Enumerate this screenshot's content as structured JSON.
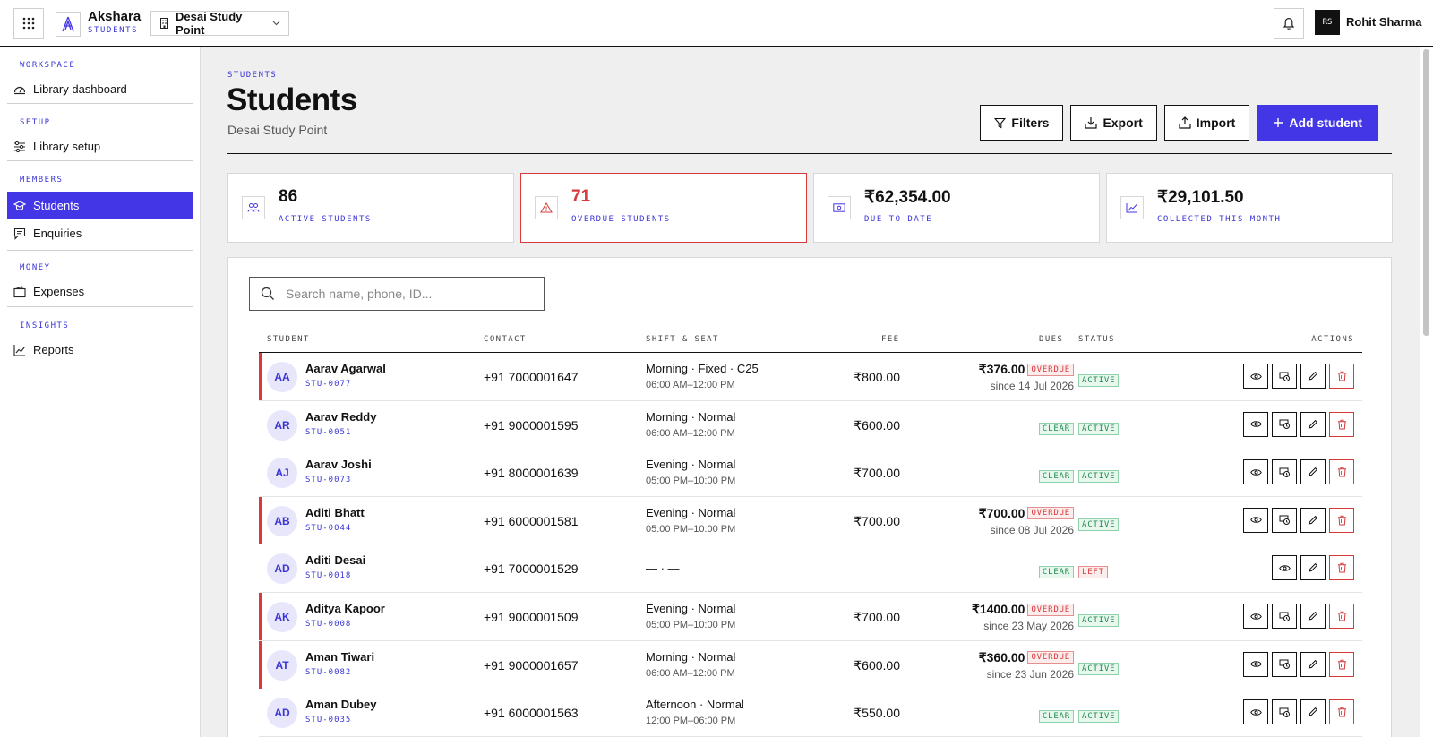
{
  "topbar": {
    "brand": "Akshara",
    "brand_sub": "STUDENTS",
    "branch": "Desai Study Point",
    "user_initials": "RS",
    "user_name": "Rohit Sharma"
  },
  "sidebar": {
    "sections": [
      {
        "label": "WORKSPACE",
        "items": [
          {
            "label": "Library dashboard",
            "icon": "dashboard-icon"
          }
        ]
      },
      {
        "label": "SETUP",
        "items": [
          {
            "label": "Library setup",
            "icon": "sliders-icon"
          }
        ]
      },
      {
        "label": "MEMBERS",
        "items": [
          {
            "label": "Students",
            "icon": "graduation-cap-icon",
            "active": true
          },
          {
            "label": "Enquiries",
            "icon": "chat-icon"
          }
        ]
      },
      {
        "label": "MONEY",
        "items": [
          {
            "label": "Expenses",
            "icon": "wallet-icon"
          }
        ]
      },
      {
        "label": "INSIGHTS",
        "items": [
          {
            "label": "Reports",
            "icon": "line-chart-icon"
          }
        ]
      }
    ]
  },
  "page": {
    "breadcrumb": "STUDENTS",
    "title": "Students",
    "subtitle": "Desai Study Point",
    "buttons": {
      "filters": "Filters",
      "export": "Export",
      "import": "Import",
      "add": "Add student"
    }
  },
  "stats": [
    {
      "value": "86",
      "label": "ACTIVE STUDENTS",
      "icon": "users-icon"
    },
    {
      "value": "71",
      "label": "OVERDUE STUDENTS",
      "icon": "warning-icon"
    },
    {
      "value": "₹62,354.00",
      "label": "DUE TO DATE",
      "icon": "cash-icon"
    },
    {
      "value": "₹29,101.50",
      "label": "COLLECTED THIS MONTH",
      "icon": "trend-icon"
    }
  ],
  "search": {
    "placeholder": "Search name, phone, ID..."
  },
  "table": {
    "headers": {
      "student": "STUDENT",
      "contact": "CONTACT",
      "shift": "SHIFT & SEAT",
      "fee": "FEE",
      "dues": "DUES",
      "status": "STATUS",
      "actions": "ACTIONS"
    },
    "rows": [
      {
        "initials": "AA",
        "name": "Aarav Agarwal",
        "id": "STU-0077",
        "contact": "+91 7000001647",
        "shift": "Morning · Fixed · C25",
        "time": "06:00 AM–12:00 PM",
        "fee": "₹800.00",
        "due_amount": "₹376.00",
        "due_badge": "OVERDUE",
        "due_since": "since 14 Jul 2026",
        "status": "ACTIVE",
        "overdue": true
      },
      {
        "initials": "AR",
        "name": "Aarav Reddy",
        "id": "STU-0051",
        "contact": "+91 9000001595",
        "shift": "Morning · Normal",
        "time": "06:00 AM–12:00 PM",
        "fee": "₹600.00",
        "due_amount": "",
        "due_badge": "CLEAR",
        "due_since": "",
        "status": "ACTIVE",
        "overdue": false
      },
      {
        "initials": "AJ",
        "name": "Aarav Joshi",
        "id": "STU-0073",
        "contact": "+91 8000001639",
        "shift": "Evening · Normal",
        "time": "05:00 PM–10:00 PM",
        "fee": "₹700.00",
        "due_amount": "",
        "due_badge": "CLEAR",
        "due_since": "",
        "status": "ACTIVE",
        "overdue": false
      },
      {
        "initials": "AB",
        "name": "Aditi Bhatt",
        "id": "STU-0044",
        "contact": "+91 6000001581",
        "shift": "Evening · Normal",
        "time": "05:00 PM–10:00 PM",
        "fee": "₹700.00",
        "due_amount": "₹700.00",
        "due_badge": "OVERDUE",
        "due_since": "since 08 Jul 2026",
        "status": "ACTIVE",
        "overdue": true
      },
      {
        "initials": "AD",
        "name": "Aditi Desai",
        "id": "STU-0018",
        "contact": "+91 7000001529",
        "shift": "— · —",
        "time": "",
        "fee": "—",
        "due_amount": "",
        "due_badge": "CLEAR",
        "due_since": "",
        "status": "LEFT",
        "overdue": false
      },
      {
        "initials": "AK",
        "name": "Aditya Kapoor",
        "id": "STU-0008",
        "contact": "+91 9000001509",
        "shift": "Evening · Normal",
        "time": "05:00 PM–10:00 PM",
        "fee": "₹700.00",
        "due_amount": "₹1400.00",
        "due_badge": "OVERDUE",
        "due_since": "since 23 May 2026",
        "status": "ACTIVE",
        "overdue": true
      },
      {
        "initials": "AT",
        "name": "Aman Tiwari",
        "id": "STU-0082",
        "contact": "+91 9000001657",
        "shift": "Morning · Normal",
        "time": "06:00 AM–12:00 PM",
        "fee": "₹600.00",
        "due_amount": "₹360.00",
        "due_badge": "OVERDUE",
        "due_since": "since 23 Jun 2026",
        "status": "ACTIVE",
        "overdue": true
      },
      {
        "initials": "AD",
        "name": "Aman Dubey",
        "id": "STU-0035",
        "contact": "+91 6000001563",
        "shift": "Afternoon · Normal",
        "time": "12:00 PM–06:00 PM",
        "fee": "₹550.00",
        "due_amount": "",
        "due_badge": "CLEAR",
        "due_since": "",
        "status": "ACTIVE",
        "overdue": false
      }
    ]
  },
  "colors": {
    "accent": "#4336e6",
    "danger": "#d63a3a",
    "success": "#1d8a4c"
  }
}
